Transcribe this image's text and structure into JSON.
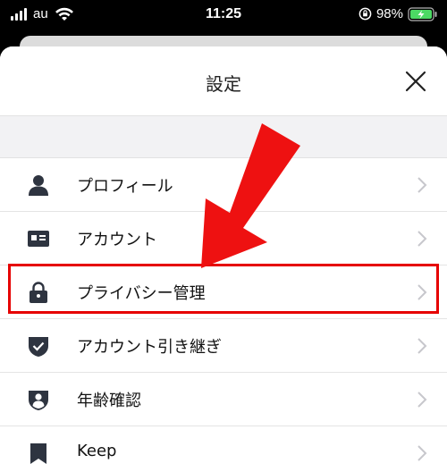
{
  "status_bar": {
    "carrier": "au",
    "time": "11:25",
    "battery": "98%"
  },
  "modal": {
    "title": "設定",
    "close_icon": "close-icon"
  },
  "menu": [
    {
      "label": "プロフィール",
      "icon": "person-icon"
    },
    {
      "label": "アカウント",
      "icon": "id-card-icon"
    },
    {
      "label": "プライバシー管理",
      "icon": "lock-icon"
    },
    {
      "label": "アカウント引き継ぎ",
      "icon": "shield-check-icon"
    },
    {
      "label": "年齢確認",
      "icon": "shield-person-icon"
    },
    {
      "label": "Keep",
      "icon": "bookmark-icon"
    }
  ],
  "colors": {
    "highlight": "#e60000",
    "icon": "#2e3440",
    "battery": "#4cd964"
  }
}
